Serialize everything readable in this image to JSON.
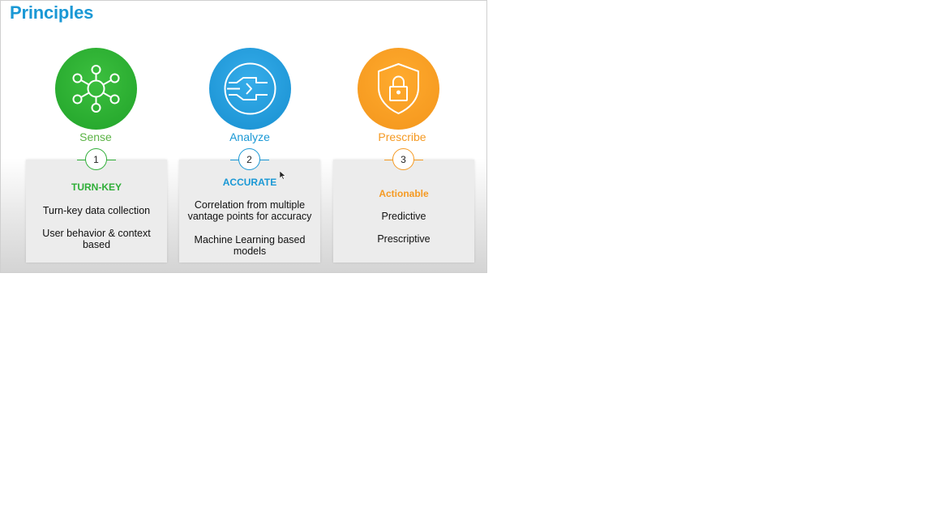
{
  "slide": {
    "title": "Principles",
    "colors": {
      "title": "#1a98d5",
      "green": "#2fae38",
      "blue": "#1a98d5",
      "orange": "#f59a23"
    },
    "stages": [
      {
        "label": "Sense",
        "number": "1",
        "icon": "network-hub-icon",
        "heading": "TURN-KEY",
        "items": [
          "Turn-key data collection",
          "User behavior & context based"
        ]
      },
      {
        "label": "Analyze",
        "number": "2",
        "icon": "convergence-icon",
        "heading": "ACCURATE",
        "items": [
          "Correlation from multiple vantage points for accuracy",
          "Machine Learning based models"
        ]
      },
      {
        "label": "Prescribe",
        "number": "3",
        "icon": "shield-lock-icon",
        "heading": "Actionable",
        "items": [
          "Predictive",
          "Prescriptive"
        ]
      }
    ]
  }
}
